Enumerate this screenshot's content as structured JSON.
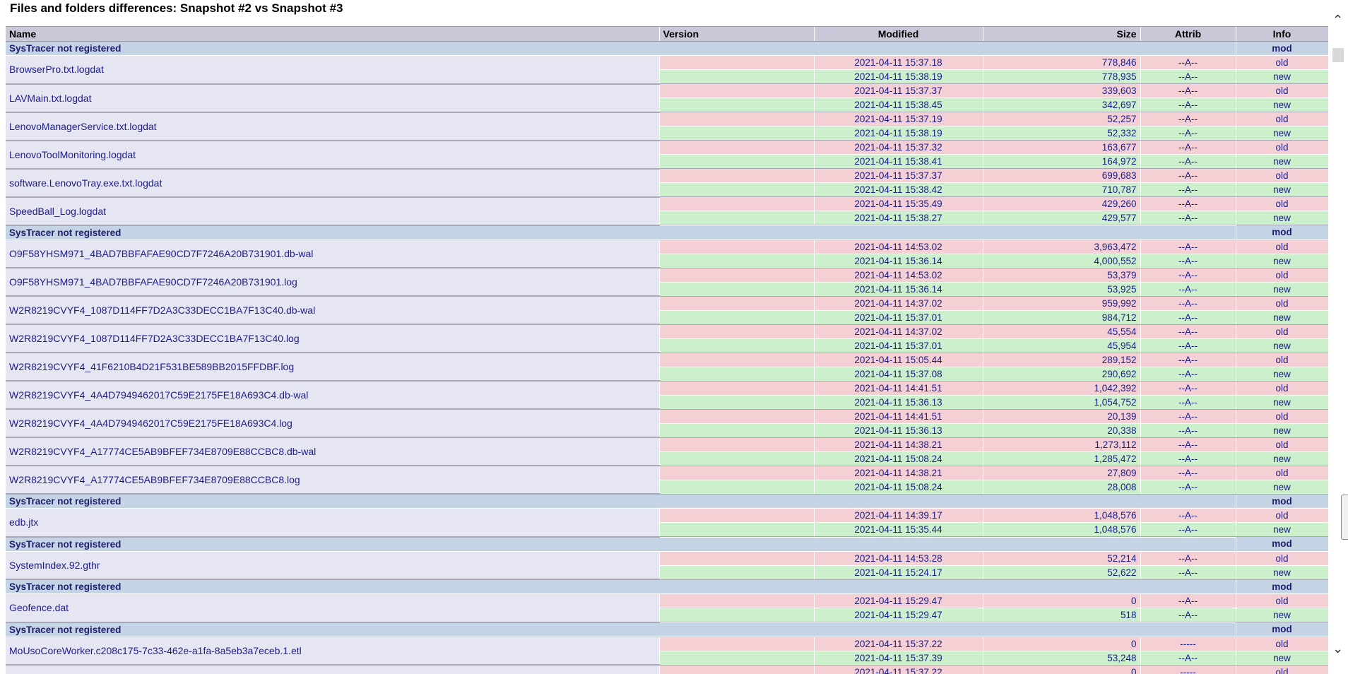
{
  "window": {
    "title": "Files and folders differences: Snapshot #2 vs Snapshot #3"
  },
  "columns": [
    "Name",
    "Version",
    "Modified",
    "Size",
    "Attrib",
    "Info"
  ],
  "colors": {
    "header": "#c8c8d8",
    "group": "#c4d4e4",
    "old": "#f4d0d4",
    "new": "#ccf0cc",
    "name_cell": "#e6e6f2"
  },
  "icons": {
    "scroll_up": "chevron-up-icon",
    "scroll_down": "chevron-down-icon"
  },
  "groups": [
    {
      "label": "SysTracer not registered",
      "info": "mod",
      "files": [
        {
          "name": "BrowserPro.txt.logdat",
          "old": {
            "modified": "2021-04-11 15:37.18",
            "size": "778,846",
            "attrib": "--A--",
            "info": "old"
          },
          "new": {
            "modified": "2021-04-11 15:38.19",
            "size": "778,935",
            "attrib": "--A--",
            "info": "new"
          }
        },
        {
          "name": "LAVMain.txt.logdat",
          "old": {
            "modified": "2021-04-11 15:37.37",
            "size": "339,603",
            "attrib": "--A--",
            "info": "old"
          },
          "new": {
            "modified": "2021-04-11 15:38.45",
            "size": "342,697",
            "attrib": "--A--",
            "info": "new"
          }
        },
        {
          "name": "LenovoManagerService.txt.logdat",
          "old": {
            "modified": "2021-04-11 15:37.19",
            "size": "52,257",
            "attrib": "--A--",
            "info": "old"
          },
          "new": {
            "modified": "2021-04-11 15:38.19",
            "size": "52,332",
            "attrib": "--A--",
            "info": "new"
          }
        },
        {
          "name": "LenovoToolMonitoring.logdat",
          "old": {
            "modified": "2021-04-11 15:37.32",
            "size": "163,677",
            "attrib": "--A--",
            "info": "old"
          },
          "new": {
            "modified": "2021-04-11 15:38.41",
            "size": "164,972",
            "attrib": "--A--",
            "info": "new"
          }
        },
        {
          "name": "software.LenovoTray.exe.txt.logdat",
          "old": {
            "modified": "2021-04-11 15:37.37",
            "size": "699,683",
            "attrib": "--A--",
            "info": "old"
          },
          "new": {
            "modified": "2021-04-11 15:38.42",
            "size": "710,787",
            "attrib": "--A--",
            "info": "new"
          }
        },
        {
          "name": "SpeedBall_Log.logdat",
          "old": {
            "modified": "2021-04-11 15:35.49",
            "size": "429,260",
            "attrib": "--A--",
            "info": "old"
          },
          "new": {
            "modified": "2021-04-11 15:38.27",
            "size": "429,577",
            "attrib": "--A--",
            "info": "new"
          }
        }
      ]
    },
    {
      "label": "SysTracer not registered",
      "info": "mod",
      "files": [
        {
          "name": "O9F58YHSM971_4BAD7BBFAFAE90CD7F7246A20B731901.db-wal",
          "old": {
            "modified": "2021-04-11 14:53.02",
            "size": "3,963,472",
            "attrib": "--A--",
            "info": "old"
          },
          "new": {
            "modified": "2021-04-11 15:36.14",
            "size": "4,000,552",
            "attrib": "--A--",
            "info": "new"
          }
        },
        {
          "name": "O9F58YHSM971_4BAD7BBFAFAE90CD7F7246A20B731901.log",
          "old": {
            "modified": "2021-04-11 14:53.02",
            "size": "53,379",
            "attrib": "--A--",
            "info": "old"
          },
          "new": {
            "modified": "2021-04-11 15:36.14",
            "size": "53,925",
            "attrib": "--A--",
            "info": "new"
          }
        },
        {
          "name": "W2R8219CVYF4_1087D114FF7D2A3C33DECC1BA7F13C40.db-wal",
          "old": {
            "modified": "2021-04-11 14:37.02",
            "size": "959,992",
            "attrib": "--A--",
            "info": "old"
          },
          "new": {
            "modified": "2021-04-11 15:37.01",
            "size": "984,712",
            "attrib": "--A--",
            "info": "new"
          }
        },
        {
          "name": "W2R8219CVYF4_1087D114FF7D2A3C33DECC1BA7F13C40.log",
          "old": {
            "modified": "2021-04-11 14:37.02",
            "size": "45,554",
            "attrib": "--A--",
            "info": "old"
          },
          "new": {
            "modified": "2021-04-11 15:37.01",
            "size": "45,954",
            "attrib": "--A--",
            "info": "new"
          }
        },
        {
          "name": "W2R8219CVYF4_41F6210B4D21F531BE589BB2015FFDBF.log",
          "old": {
            "modified": "2021-04-11 15:05.44",
            "size": "289,152",
            "attrib": "--A--",
            "info": "old"
          },
          "new": {
            "modified": "2021-04-11 15:37.08",
            "size": "290,692",
            "attrib": "--A--",
            "info": "new"
          }
        },
        {
          "name": "W2R8219CVYF4_4A4D7949462017C59E2175FE18A693C4.db-wal",
          "old": {
            "modified": "2021-04-11 14:41.51",
            "size": "1,042,392",
            "attrib": "--A--",
            "info": "old"
          },
          "new": {
            "modified": "2021-04-11 15:36.13",
            "size": "1,054,752",
            "attrib": "--A--",
            "info": "new"
          }
        },
        {
          "name": "W2R8219CVYF4_4A4D7949462017C59E2175FE18A693C4.log",
          "old": {
            "modified": "2021-04-11 14:41.51",
            "size": "20,139",
            "attrib": "--A--",
            "info": "old"
          },
          "new": {
            "modified": "2021-04-11 15:36.13",
            "size": "20,338",
            "attrib": "--A--",
            "info": "new"
          }
        },
        {
          "name": "W2R8219CVYF4_A17774CE5AB9BFEF734E8709E88CCBC8.db-wal",
          "old": {
            "modified": "2021-04-11 14:38.21",
            "size": "1,273,112",
            "attrib": "--A--",
            "info": "old"
          },
          "new": {
            "modified": "2021-04-11 15:08.24",
            "size": "1,285,472",
            "attrib": "--A--",
            "info": "new"
          }
        },
        {
          "name": "W2R8219CVYF4_A17774CE5AB9BFEF734E8709E88CCBC8.log",
          "old": {
            "modified": "2021-04-11 14:38.21",
            "size": "27,809",
            "attrib": "--A--",
            "info": "old"
          },
          "new": {
            "modified": "2021-04-11 15:08.24",
            "size": "28,008",
            "attrib": "--A--",
            "info": "new"
          }
        }
      ]
    },
    {
      "label": "SysTracer not registered",
      "info": "mod",
      "files": [
        {
          "name": "edb.jtx",
          "old": {
            "modified": "2021-04-11 14:39.17",
            "size": "1,048,576",
            "attrib": "--A--",
            "info": "old"
          },
          "new": {
            "modified": "2021-04-11 15:35.44",
            "size": "1,048,576",
            "attrib": "--A--",
            "info": "new"
          }
        }
      ]
    },
    {
      "label": "SysTracer not registered",
      "info": "mod",
      "files": [
        {
          "name": "SystemIndex.92.gthr",
          "old": {
            "modified": "2021-04-11 14:53.28",
            "size": "52,214",
            "attrib": "--A--",
            "info": "old"
          },
          "new": {
            "modified": "2021-04-11 15:24.17",
            "size": "52,622",
            "attrib": "--A--",
            "info": "new"
          }
        }
      ]
    },
    {
      "label": "SysTracer not registered",
      "info": "mod",
      "files": [
        {
          "name": "Geofence.dat",
          "old": {
            "modified": "2021-04-11 15:29.47",
            "size": "0",
            "attrib": "--A--",
            "info": "old"
          },
          "new": {
            "modified": "2021-04-11 15:29.47",
            "size": "518",
            "attrib": "--A--",
            "info": "new"
          }
        }
      ]
    },
    {
      "label": "SysTracer not registered",
      "info": "mod",
      "files": [
        {
          "name": "MoUsoCoreWorker.c208c175-7c33-462e-a1fa-8a5eb3a7eceb.1.etl",
          "old": {
            "modified": "2021-04-11 15:37.22",
            "size": "0",
            "attrib": "-----",
            "info": "old"
          },
          "new": {
            "modified": "2021-04-11 15:37.39",
            "size": "53,248",
            "attrib": "--A--",
            "info": "new"
          }
        },
        {
          "name": "",
          "old": {
            "modified": "2021-04-11 15:37.22",
            "size": "0",
            "attrib": "-----",
            "info": "old"
          },
          "new": null
        }
      ]
    }
  ]
}
